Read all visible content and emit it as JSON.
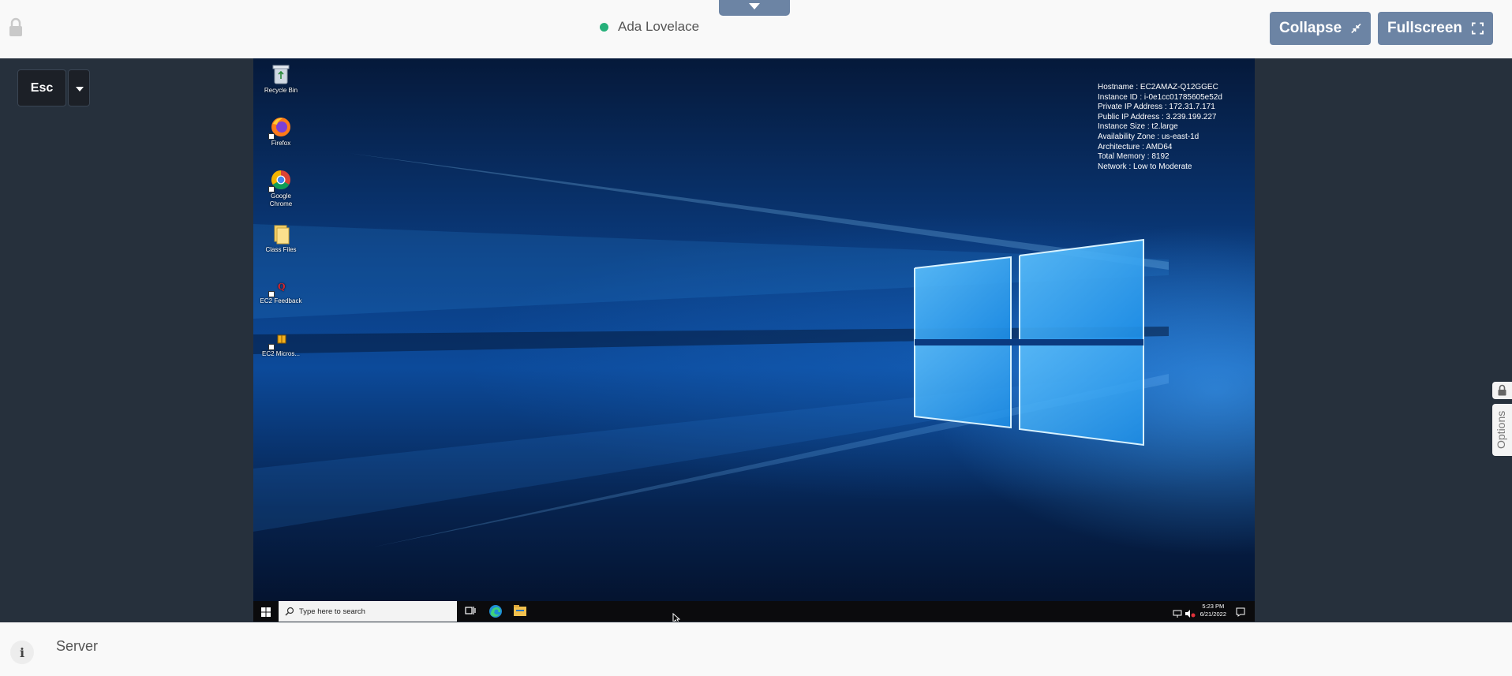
{
  "header": {
    "user_name": "Ada Lovelace",
    "user_status_color": "#26b07a",
    "collapse_label": "Collapse",
    "fullscreen_label": "Fullscreen",
    "lock_icon": "lock-icon",
    "toggle_icon": "chevron-down-icon"
  },
  "controls": {
    "esc_label": "Esc"
  },
  "desktop": {
    "icons": [
      {
        "label": "Recycle Bin"
      },
      {
        "label": "Firefox"
      },
      {
        "label": "Google Chrome"
      },
      {
        "label": "Class Files"
      },
      {
        "label": "EC2 Feedback"
      },
      {
        "label": "EC2 Micros..."
      }
    ],
    "sysinfo": [
      "Hostname : EC2AMAZ-Q12GGEC",
      "Instance ID : i-0e1cc01785605e52d",
      "Private IP Address : 172.31.7.171",
      "Public IP Address : 3.239.199.227",
      "Instance Size : t2.large",
      "Availability Zone : us-east-1d",
      "Architecture : AMD64",
      "Total Memory : 8192",
      "Network : Low to Moderate"
    ],
    "taskbar": {
      "search_placeholder": "Type here to search",
      "time": "5:23 PM",
      "date": "6/21/2022"
    }
  },
  "side": {
    "options_label": "Options"
  },
  "footer": {
    "server_label": "Server",
    "info_label": "i"
  },
  "colors": {
    "accent_button": "#6c84a4",
    "page_background": "#26303c",
    "bar_background": "#f9f9f9"
  }
}
